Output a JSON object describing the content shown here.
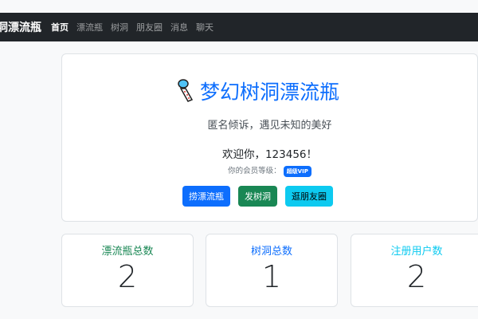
{
  "navbar": {
    "brand": "洞漂流瓶",
    "items": [
      {
        "label": "首页",
        "active": true
      },
      {
        "label": "漂流瓶"
      },
      {
        "label": "树洞"
      },
      {
        "label": "朋友圈"
      },
      {
        "label": "消息"
      },
      {
        "label": "聊天"
      }
    ]
  },
  "hero": {
    "icon": "scroll-lantern-icon",
    "title": "梦幻树洞漂流瓶",
    "subtitle": "匿名倾诉，遇见未知的美好",
    "welcome": "欢迎你，123456！",
    "vip_label": "你的会员等级：",
    "vip_badge": "超级VIP",
    "buttons": [
      {
        "label": "捞漂流瓶",
        "color": "#0d6efd"
      },
      {
        "label": "发树洞",
        "color": "#198754"
      },
      {
        "label": "逛朋友圈",
        "color": "#0dcaf0"
      }
    ]
  },
  "stats": [
    {
      "label": "漂流瓶总数",
      "value": "2",
      "color": "#198754"
    },
    {
      "label": "树洞总数",
      "value": "1",
      "color": "#0d6efd"
    },
    {
      "label": "注册用户数",
      "value": "2",
      "color": "#0dcaf0"
    }
  ]
}
